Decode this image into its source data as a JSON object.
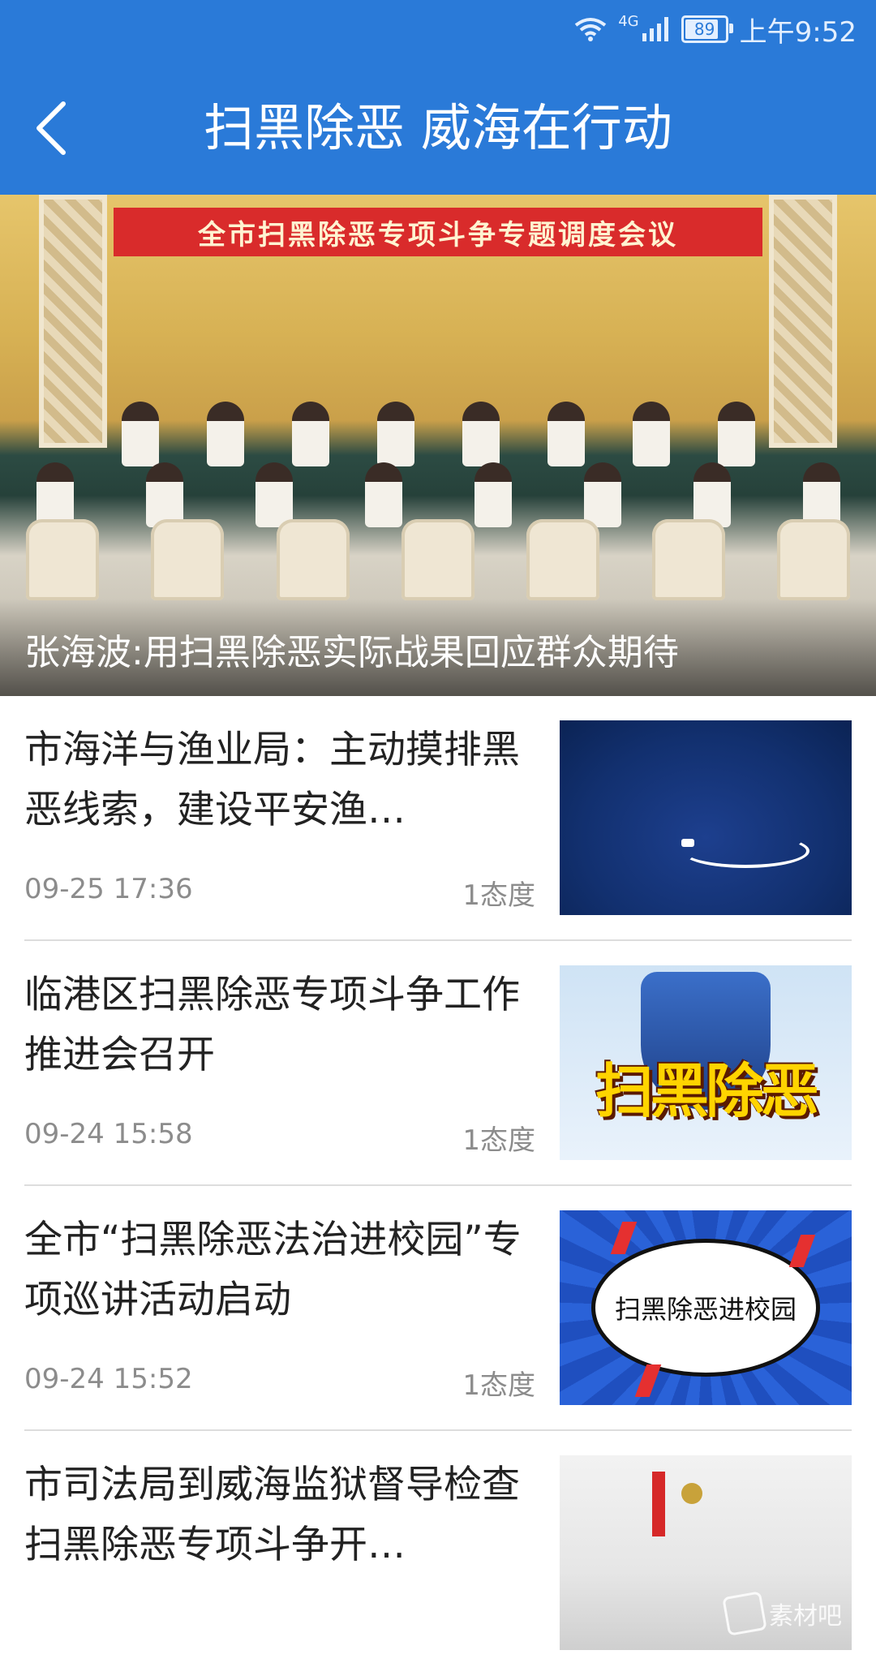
{
  "status_bar": {
    "network": "4G",
    "battery": "89",
    "time": "上午9:52"
  },
  "header": {
    "title": "扫黑除恶 威海在行动"
  },
  "hero": {
    "banner_text": "全市扫黑除恶专项斗争专题调度会议",
    "caption": "张海波:用扫黑除恶实际战果回应群众期待"
  },
  "news": [
    {
      "title": "市海洋与渔业局：主动摸排黑恶线索，建设平安渔…",
      "date": "09-25 17:36",
      "count": "1态度"
    },
    {
      "title": "临港区扫黑除恶专项斗争工作推进会召开",
      "date": "09-24 15:58",
      "count": "1态度",
      "thumb_text": "扫黑除恶"
    },
    {
      "title": "全市“扫黑除恶法治进校园”专项巡讲活动启动",
      "date": "09-24 15:52",
      "count": "1态度",
      "thumb_text": "扫黑除恶进校园"
    },
    {
      "title": "市司法局到威海监狱督导检查扫黑除恶专项斗争开…",
      "date": "",
      "count": ""
    }
  ],
  "watermark": "素材吧",
  "colors": {
    "header_bg": "#2a7ad8",
    "title_text": "#222222",
    "meta_text": "#8c8c8c"
  },
  "icons": [
    "wifi-icon",
    "signal-icon",
    "battery-icon",
    "back-arrow-icon"
  ]
}
